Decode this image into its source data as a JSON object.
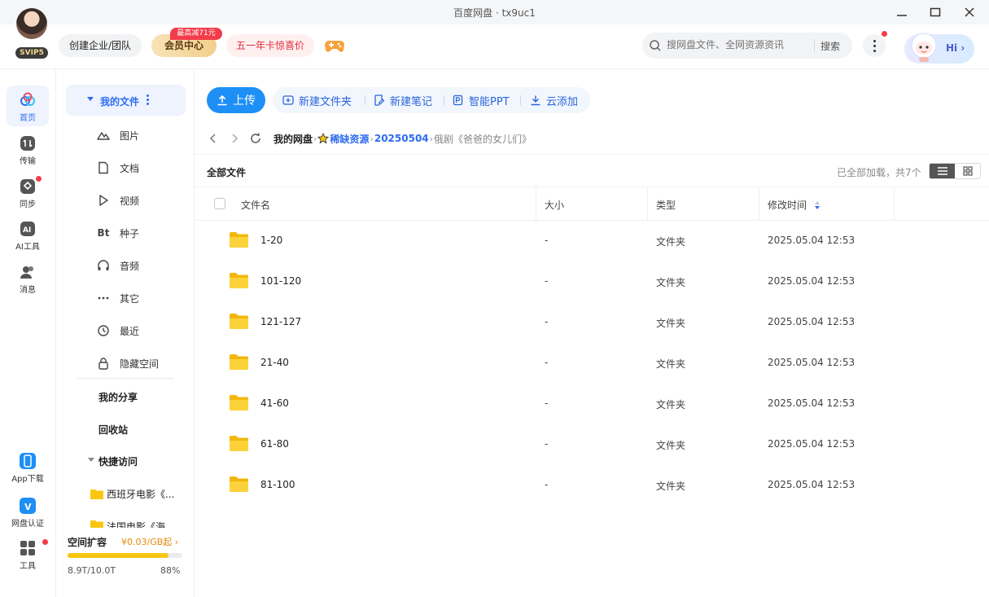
{
  "window": {
    "title": "百度网盘 · tx9uc1"
  },
  "header": {
    "svip_badge": "SVIP5",
    "enterprise_label": "创建企业/团队",
    "vip_center_label": "会员中心",
    "vip_discount_badge": "最高减71元",
    "promo_label": "五一年卡惊喜价",
    "search": {
      "placeholder": "搜网盘文件、全网资源资讯",
      "button_label": "搜索"
    },
    "hi_label": "Hi"
  },
  "rail": {
    "items": [
      {
        "label": "首页",
        "icon": "home-icon"
      },
      {
        "label": "传输",
        "icon": "transfer-icon"
      },
      {
        "label": "同步",
        "icon": "sync-icon"
      },
      {
        "label": "AI工具",
        "icon": "ai-tools-icon"
      },
      {
        "label": "消息",
        "icon": "message-icon"
      },
      {
        "label": "App下载",
        "icon": "app-download-icon"
      },
      {
        "label": "网盘认证",
        "icon": "verify-icon"
      },
      {
        "label": "工具",
        "icon": "tools-icon"
      }
    ]
  },
  "sidebar": {
    "my_files_label": "我的文件",
    "categories": [
      {
        "label": "图片",
        "icon": "image-icon"
      },
      {
        "label": "文档",
        "icon": "document-icon"
      },
      {
        "label": "视频",
        "icon": "video-icon"
      },
      {
        "label": "种子",
        "icon": "bt-icon",
        "glyph": "Bt"
      },
      {
        "label": "音频",
        "icon": "audio-icon"
      },
      {
        "label": "其它",
        "icon": "other-icon"
      },
      {
        "label": "最近",
        "icon": "recent-icon"
      },
      {
        "label": "隐藏空间",
        "icon": "lock-icon"
      }
    ],
    "my_share_label": "我的分享",
    "recycle_label": "回收站",
    "quick_access_label": "快捷访问",
    "quick_items": [
      {
        "label": "西班牙电影《..."
      },
      {
        "label": "法国电影《海"
      }
    ],
    "storage": {
      "title": "空间扩容",
      "price": "¥0.03/GB起",
      "used_text": "8.9T/10.0T",
      "percent_text": "88%",
      "used_fraction": 0.88,
      "bar_color": "#f9c712"
    }
  },
  "toolbar": {
    "upload_label": "上传",
    "new_folder_label": "新建文件夹",
    "new_note_label": "新建笔记",
    "smart_ppt_label": "智能PPT",
    "cloud_add_label": "云添加"
  },
  "breadcrumb": {
    "root": "我的网盘",
    "level1": "稀缺资源",
    "level2": "20250504",
    "current": "俄剧《爸爸的女儿们》",
    "separator": "›"
  },
  "section": {
    "title": "全部文件",
    "loaded_text": "已全部加载，共7个"
  },
  "table": {
    "columns": {
      "name": "文件名",
      "size": "大小",
      "type": "类型",
      "mtime": "修改时间"
    },
    "rows": [
      {
        "name": "1-20",
        "size": "-",
        "type": "文件夹",
        "mtime": "2025.05.04 12:53"
      },
      {
        "name": "101-120",
        "size": "-",
        "type": "文件夹",
        "mtime": "2025.05.04 12:53"
      },
      {
        "name": "121-127",
        "size": "-",
        "type": "文件夹",
        "mtime": "2025.05.04 12:53"
      },
      {
        "name": "21-40",
        "size": "-",
        "type": "文件夹",
        "mtime": "2025.05.04 12:53"
      },
      {
        "name": "41-60",
        "size": "-",
        "type": "文件夹",
        "mtime": "2025.05.04 12:53"
      },
      {
        "name": "61-80",
        "size": "-",
        "type": "文件夹",
        "mtime": "2025.05.04 12:53"
      },
      {
        "name": "81-100",
        "size": "-",
        "type": "文件夹",
        "mtime": "2025.05.04 12:53"
      }
    ]
  },
  "colors": {
    "accent_blue": "#2d6cf0",
    "upload_blue": "#1e8ff5",
    "folder_yellow": "#f9c712",
    "badge_red": "#f23c4a"
  }
}
